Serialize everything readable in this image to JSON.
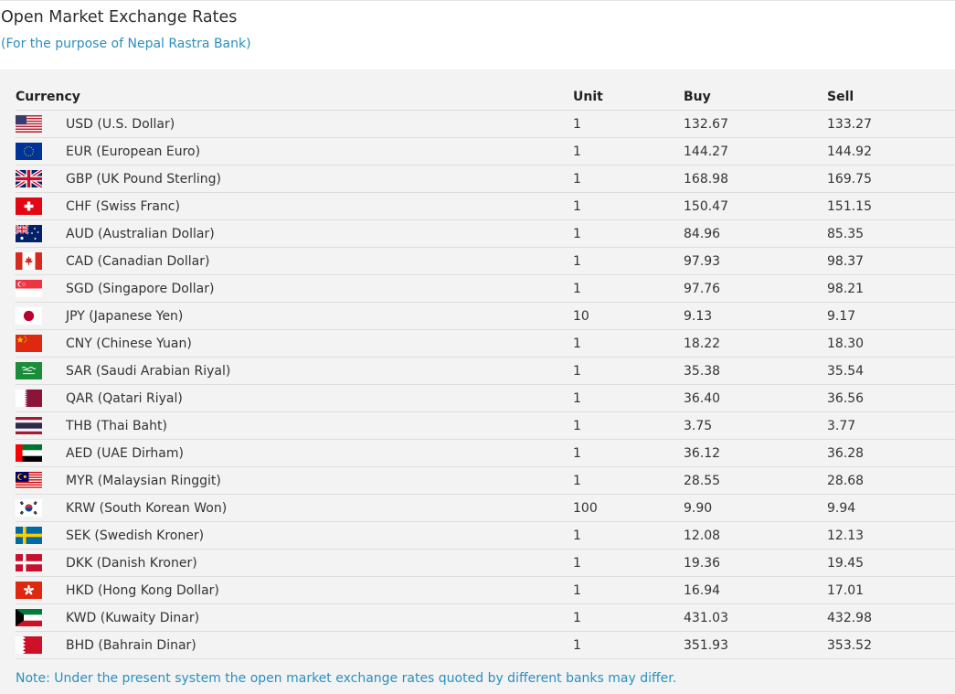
{
  "page": {
    "title": "Open Market Exchange Rates",
    "subtitle": "(For the purpose of Nepal Rastra Bank)",
    "note": "Note: Under the present system the open market exchange rates quoted by different banks may differ."
  },
  "table": {
    "headers": {
      "currency": "Currency",
      "unit": "Unit",
      "buy": "Buy",
      "sell": "Sell"
    },
    "rows": [
      {
        "flag_icon": "usa-flag-icon",
        "currency": "USD (U.S. Dollar)",
        "unit": "1",
        "buy": "132.67",
        "sell": "133.27"
      },
      {
        "flag_icon": "eu-flag-icon",
        "currency": "EUR (European Euro)",
        "unit": "1",
        "buy": "144.27",
        "sell": "144.92"
      },
      {
        "flag_icon": "uk-flag-icon",
        "currency": "GBP (UK Pound Sterling)",
        "unit": "1",
        "buy": "168.98",
        "sell": "169.75"
      },
      {
        "flag_icon": "switzerland-flag-icon",
        "currency": "CHF (Swiss Franc)",
        "unit": "1",
        "buy": "150.47",
        "sell": "151.15"
      },
      {
        "flag_icon": "australia-flag-icon",
        "currency": "AUD (Australian Dollar)",
        "unit": "1",
        "buy": "84.96",
        "sell": "85.35"
      },
      {
        "flag_icon": "canada-flag-icon",
        "currency": "CAD (Canadian Dollar)",
        "unit": "1",
        "buy": "97.93",
        "sell": "98.37"
      },
      {
        "flag_icon": "singapore-flag-icon",
        "currency": "SGD (Singapore Dollar)",
        "unit": "1",
        "buy": "97.76",
        "sell": "98.21"
      },
      {
        "flag_icon": "japan-flag-icon",
        "currency": "JPY (Japanese Yen)",
        "unit": "10",
        "buy": "9.13",
        "sell": "9.17"
      },
      {
        "flag_icon": "china-flag-icon",
        "currency": "CNY (Chinese Yuan)",
        "unit": "1",
        "buy": "18.22",
        "sell": "18.30"
      },
      {
        "flag_icon": "saudi-arabia-flag-icon",
        "currency": "SAR (Saudi Arabian Riyal)",
        "unit": "1",
        "buy": "35.38",
        "sell": "35.54"
      },
      {
        "flag_icon": "qatar-flag-icon",
        "currency": "QAR (Qatari Riyal)",
        "unit": "1",
        "buy": "36.40",
        "sell": "36.56"
      },
      {
        "flag_icon": "thailand-flag-icon",
        "currency": "THB (Thai Baht)",
        "unit": "1",
        "buy": "3.75",
        "sell": "3.77"
      },
      {
        "flag_icon": "uae-flag-icon",
        "currency": "AED (UAE Dirham)",
        "unit": "1",
        "buy": "36.12",
        "sell": "36.28"
      },
      {
        "flag_icon": "malaysia-flag-icon",
        "currency": "MYR (Malaysian Ringgit)",
        "unit": "1",
        "buy": "28.55",
        "sell": "28.68"
      },
      {
        "flag_icon": "south-korea-flag-icon",
        "currency": "KRW (South Korean Won)",
        "unit": "100",
        "buy": "9.90",
        "sell": "9.94"
      },
      {
        "flag_icon": "sweden-flag-icon",
        "currency": "SEK (Swedish Kroner)",
        "unit": "1",
        "buy": "12.08",
        "sell": "12.13"
      },
      {
        "flag_icon": "denmark-flag-icon",
        "currency": "DKK (Danish Kroner)",
        "unit": "1",
        "buy": "19.36",
        "sell": "19.45"
      },
      {
        "flag_icon": "hong-kong-flag-icon",
        "currency": "HKD (Hong Kong Dollar)",
        "unit": "1",
        "buy": "16.94",
        "sell": "17.01"
      },
      {
        "flag_icon": "kuwait-flag-icon",
        "currency": "KWD (Kuwaity Dinar)",
        "unit": "1",
        "buy": "431.03",
        "sell": "432.98"
      },
      {
        "flag_icon": "bahrain-flag-icon",
        "currency": "BHD (Bahrain Dinar)",
        "unit": "1",
        "buy": "351.93",
        "sell": "353.52"
      }
    ]
  },
  "colors": {
    "link_blue": "#2a8fbd",
    "panel_bg": "#f3f3f3",
    "row_border": "#dddddd"
  }
}
